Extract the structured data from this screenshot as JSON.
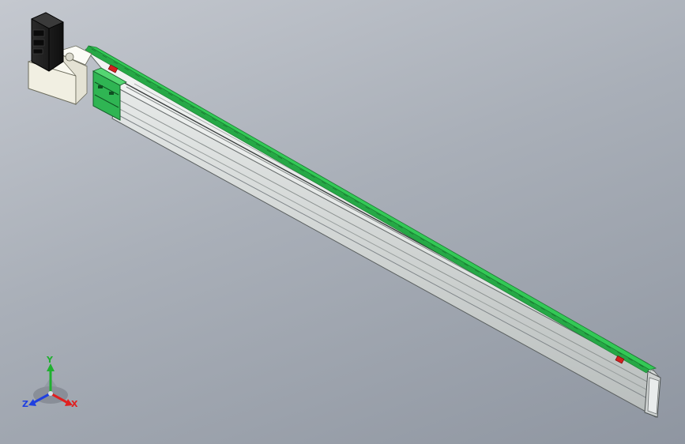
{
  "viewport": {
    "background_top": "#c4c8cf",
    "background_bottom": "#8f96a1"
  },
  "model": {
    "rail_color": "#dfe3e2",
    "guide_color": "#33c956",
    "motor_color": "#1e1e1e",
    "marker_color": "#d42020"
  },
  "triad": {
    "x_label": "X",
    "y_label": "Y",
    "z_label": "Z",
    "x_color": "#e02020",
    "y_color": "#20b030",
    "z_color": "#2040e0"
  }
}
